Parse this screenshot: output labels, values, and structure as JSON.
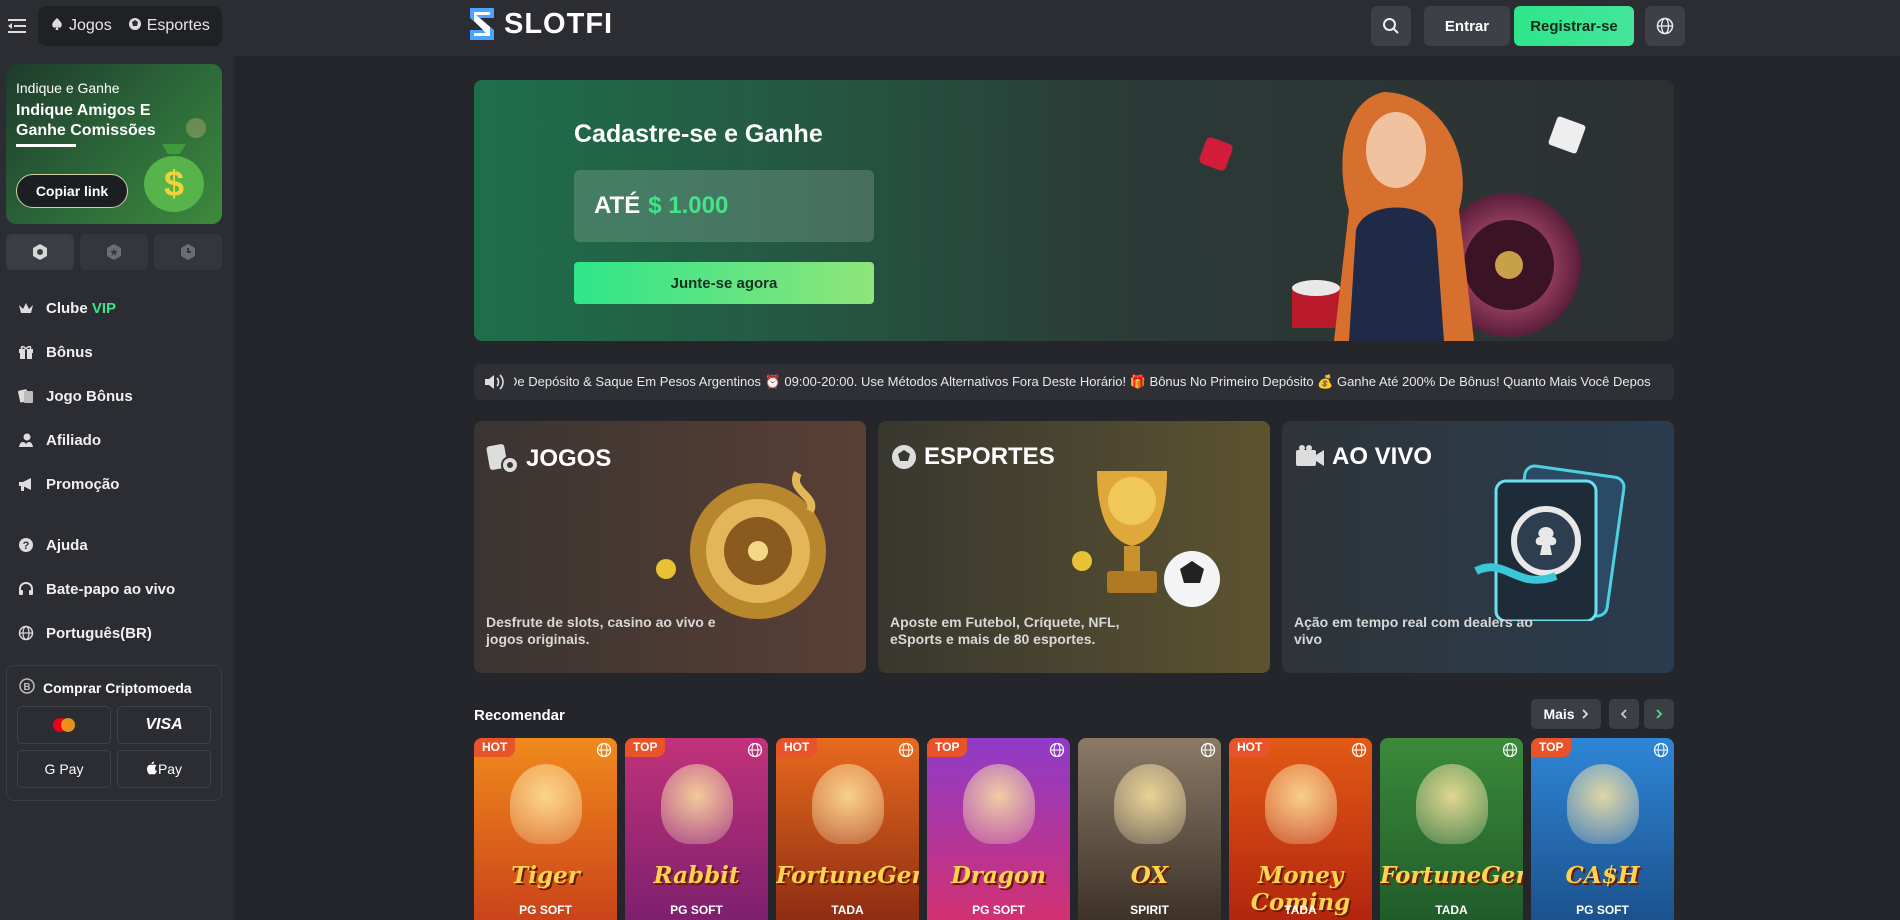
{
  "sidebar": {
    "nav": [
      {
        "label": "Jogos",
        "icon": "spade-icon"
      },
      {
        "label": "Esportes",
        "icon": "ball-icon"
      }
    ],
    "promo": {
      "line1": "Indique e Ganhe",
      "line2": "Indique Amigos E Ganhe Comissões",
      "button": "Copiar link"
    },
    "menu": [
      {
        "label": "Clube",
        "accent": "VIP",
        "icon": "crown-icon"
      },
      {
        "label": "Bônus",
        "icon": "gift-icon"
      },
      {
        "label": "Jogo Bônus",
        "icon": "cards-icon"
      },
      {
        "label": "Afiliado",
        "icon": "affiliate-icon"
      },
      {
        "label": "Promoção",
        "icon": "megaphone-icon"
      }
    ],
    "menu2": [
      {
        "label": "Ajuda",
        "icon": "help-icon"
      },
      {
        "label": "Bate-papo ao vivo",
        "icon": "headset-icon"
      },
      {
        "label": "Português(BR)",
        "icon": "globe-icon"
      }
    ],
    "crypto": {
      "title": "Comprar Criptomoeda",
      "methods": [
        "Mastercard",
        "VISA",
        "G Pay",
        "Pay"
      ]
    }
  },
  "header": {
    "logo": "SLOTFI",
    "login": "Entrar",
    "register": "Registrar-se"
  },
  "hero": {
    "title": "Cadastre-se e Ganhe",
    "prefix": "ATÉ",
    "amount": "$ 1.000",
    "button": "Junte-se agora"
  },
  "marquee": {
    "text": "De Depósito & Saque Em Pesos Argentinos ⏰ 09:00-20:00. Use Métodos Alternativos Fora Deste Horário!          🎁 Bônus No Primeiro Depósito 💰 Ganhe Até 200% De Bônus! Quanto Mais Você Depos"
  },
  "categories": [
    {
      "title": "JOGOS",
      "desc": "Desfrute de slots, casino ao vivo e jogos originais."
    },
    {
      "title": "ESPORTES",
      "desc": "Aposte em Futebol, Críquete, NFL, eSports e mais de 80 esportes."
    },
    {
      "title": "AO VIVO",
      "desc": "Ação em tempo real com dealers ao vivo"
    }
  ],
  "recommend": {
    "title": "Recomendar",
    "more": "Mais",
    "games": [
      {
        "tag": "HOT",
        "name": "Tiger",
        "provider": "PG SOFT",
        "colors": [
          "#f08a1c",
          "#c9401a"
        ]
      },
      {
        "tag": "TOP",
        "name": "Rabbit",
        "provider": "PG SOFT",
        "colors": [
          "#c2327a",
          "#7a1f6e"
        ]
      },
      {
        "tag": "HOT",
        "name": "FortuneGems",
        "provider": "TADA",
        "colors": [
          "#e86a1e",
          "#8a2a12"
        ]
      },
      {
        "tag": "TOP",
        "name": "Dragon",
        "provider": "PG SOFT",
        "colors": [
          "#8e3bc9",
          "#d4306e"
        ]
      },
      {
        "tag": "",
        "name": "OX",
        "provider": "SPIRIT",
        "colors": [
          "#8a7a66",
          "#3a2f26"
        ]
      },
      {
        "tag": "HOT",
        "name": "Money Coming",
        "provider": "TADA",
        "colors": [
          "#e25a14",
          "#b0230f"
        ]
      },
      {
        "tag": "",
        "name": "FortuneGems",
        "provider": "TADA",
        "colors": [
          "#3b8a3a",
          "#1f5a2a"
        ]
      },
      {
        "tag": "TOP",
        "name": "CA$H",
        "provider": "PG SOFT",
        "colors": [
          "#2e86d6",
          "#1b4f8a"
        ]
      }
    ]
  }
}
